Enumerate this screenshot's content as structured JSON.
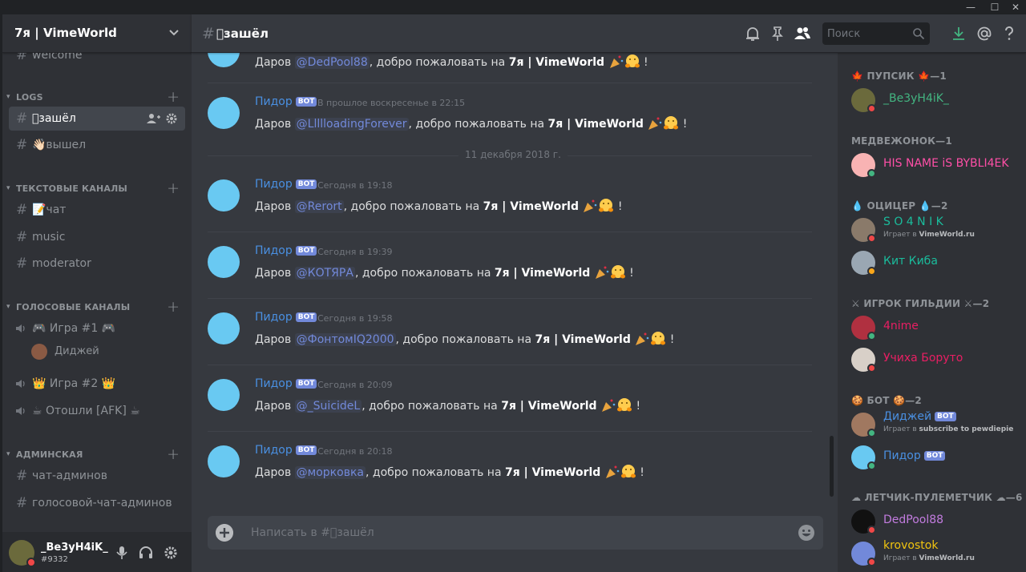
{
  "window": {
    "minimize": "—",
    "maximize": "☐",
    "close": "✕"
  },
  "server": {
    "name": "7я | VimeWorld"
  },
  "sidebar": {
    "partial_channel": "welcome",
    "categories": [
      {
        "label": "LOGS"
      },
      {
        "label": "ТЕКСТОВЫЕ КАНАЛЫ"
      },
      {
        "label": "ГОЛОСОВЫЕ КАНАЛЫ"
      },
      {
        "label": "АДМИНСКАЯ"
      }
    ],
    "channels": {
      "zashel": "\u0000зашёл",
      "vyshel": "👋🏻вышел",
      "chat": "📝чат",
      "music": "music",
      "moderator": "moderator",
      "game1": "🎮 Игра #1 🎮",
      "game1_user": "Диджей",
      "game2": "👑 Игра #2 👑",
      "afk": "☕ Отошли [AFK] ☕",
      "admin_chat": "чат-админов",
      "admin_voice": "голосовой-чат-админов"
    }
  },
  "user_panel": {
    "name": "_Be3yH4iK_",
    "tag": "#9332"
  },
  "chat": {
    "channel_title": "\u0000зашёл",
    "search_placeholder": "Поиск",
    "composer_placeholder": "Написать в #\u0000зашёл",
    "date_divider": "11 декабря 2018 г.",
    "bot_badge": "BOT",
    "greeting_prefix": "Даров ",
    "greeting_middle": ", добро пожаловать на ",
    "server_bold": "7я | VimeWorld",
    "greeting_suffix": " !",
    "partial_message": {
      "mention": "@DedPool88"
    },
    "messages": [
      {
        "author": "Пидор",
        "time": "В прошлое воскресенье в 22:15",
        "mention": "@LlllloadingForever"
      },
      {
        "author": "Пидор",
        "time": "Сегодня в 19:18",
        "mention": "@Rerort"
      },
      {
        "author": "Пидор",
        "time": "Сегодня в 19:39",
        "mention": "@КОТЯРА"
      },
      {
        "author": "Пидор",
        "time": "Сегодня в 19:58",
        "mention": "@ФонтомIQ2000"
      },
      {
        "author": "Пидор",
        "time": "Сегодня в 20:09",
        "mention": "@_SuicideL"
      },
      {
        "author": "Пидор",
        "time": "Сегодня в 20:18",
        "mention": "@морковка"
      }
    ]
  },
  "members": {
    "groups": [
      {
        "label": "🍁 ПУПСИК 🍁—1"
      },
      {
        "label": "МЕДВЕЖОНОК—1"
      },
      {
        "label": "💧 ОЦИЦЕР 💧—2"
      },
      {
        "label": "⚔ ИГРОК ГИЛЬДИИ ⚔—2"
      },
      {
        "label": "🍪 БОТ 🍪—2"
      },
      {
        "label": "☁ ЛЕТЧИК-ПУЛЕМЕТЧИК ☁—6"
      }
    ],
    "list": [
      {
        "name": "_Be3yH4iK_",
        "color": "#43b581",
        "status": "#f04747"
      },
      {
        "name": "HIS NAME iS BYBLI4EK",
        "color": "#ff4fa7",
        "status": "#43b581"
      },
      {
        "name": "S O 4 N I K",
        "color": "#1abc9c",
        "status": "#f04747",
        "activity_prefix": "Играет в ",
        "activity": "VimeWorld.ru"
      },
      {
        "name": "Кит Киба",
        "color": "#1abc9c",
        "status": "#faa61a"
      },
      {
        "name": "4nime",
        "color": "#e91e63",
        "status": "#43b581"
      },
      {
        "name": "Учиха Боруто",
        "color": "#e91e63",
        "status": "#f04747"
      },
      {
        "name": "Диджей",
        "color": "#4a90e2",
        "status": "#43b581",
        "activity_prefix": "Играет в ",
        "activity": "subscribe to pewdiepie"
      },
      {
        "name": "Пидор",
        "color": "#4a90e2",
        "status": "#43b581"
      },
      {
        "name": "DedPool88",
        "color": "#c27cdf",
        "status": "#f04747"
      },
      {
        "name": "krovostok",
        "color": "#f1c40f",
        "status": "#f04747",
        "activity_prefix": "Играет в ",
        "activity": "VimeWorld.ru"
      }
    ]
  },
  "colors": {
    "accent": "#7289da",
    "bot_author": "#4a90e2",
    "online": "#43b581",
    "dnd": "#f04747",
    "idle": "#faa61a"
  }
}
